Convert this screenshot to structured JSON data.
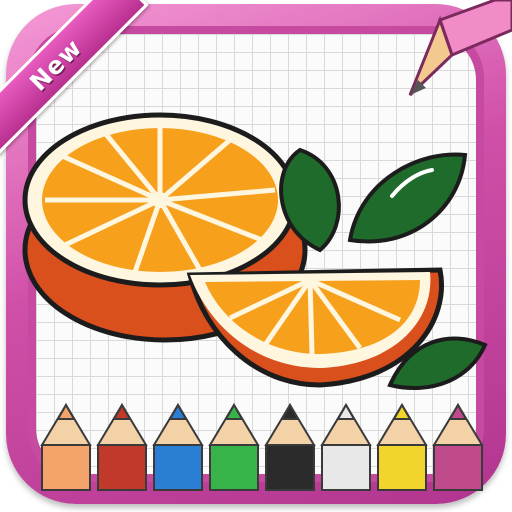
{
  "badge": {
    "label": "New"
  },
  "illustration": {
    "subject": "orange",
    "leaf_count": 3
  },
  "pencils": {
    "colors": [
      "#f4a46a",
      "#c0392b",
      "#2a7fd4",
      "#38b34a",
      "#2b2b2b",
      "#e8e8e8",
      "#f2d52c",
      "#c04b8c"
    ]
  },
  "colors": {
    "frame": "#d04fa8",
    "orange_fill": "#f7a01c",
    "orange_peel": "#d9501c",
    "leaf": "#1e6b2b"
  }
}
